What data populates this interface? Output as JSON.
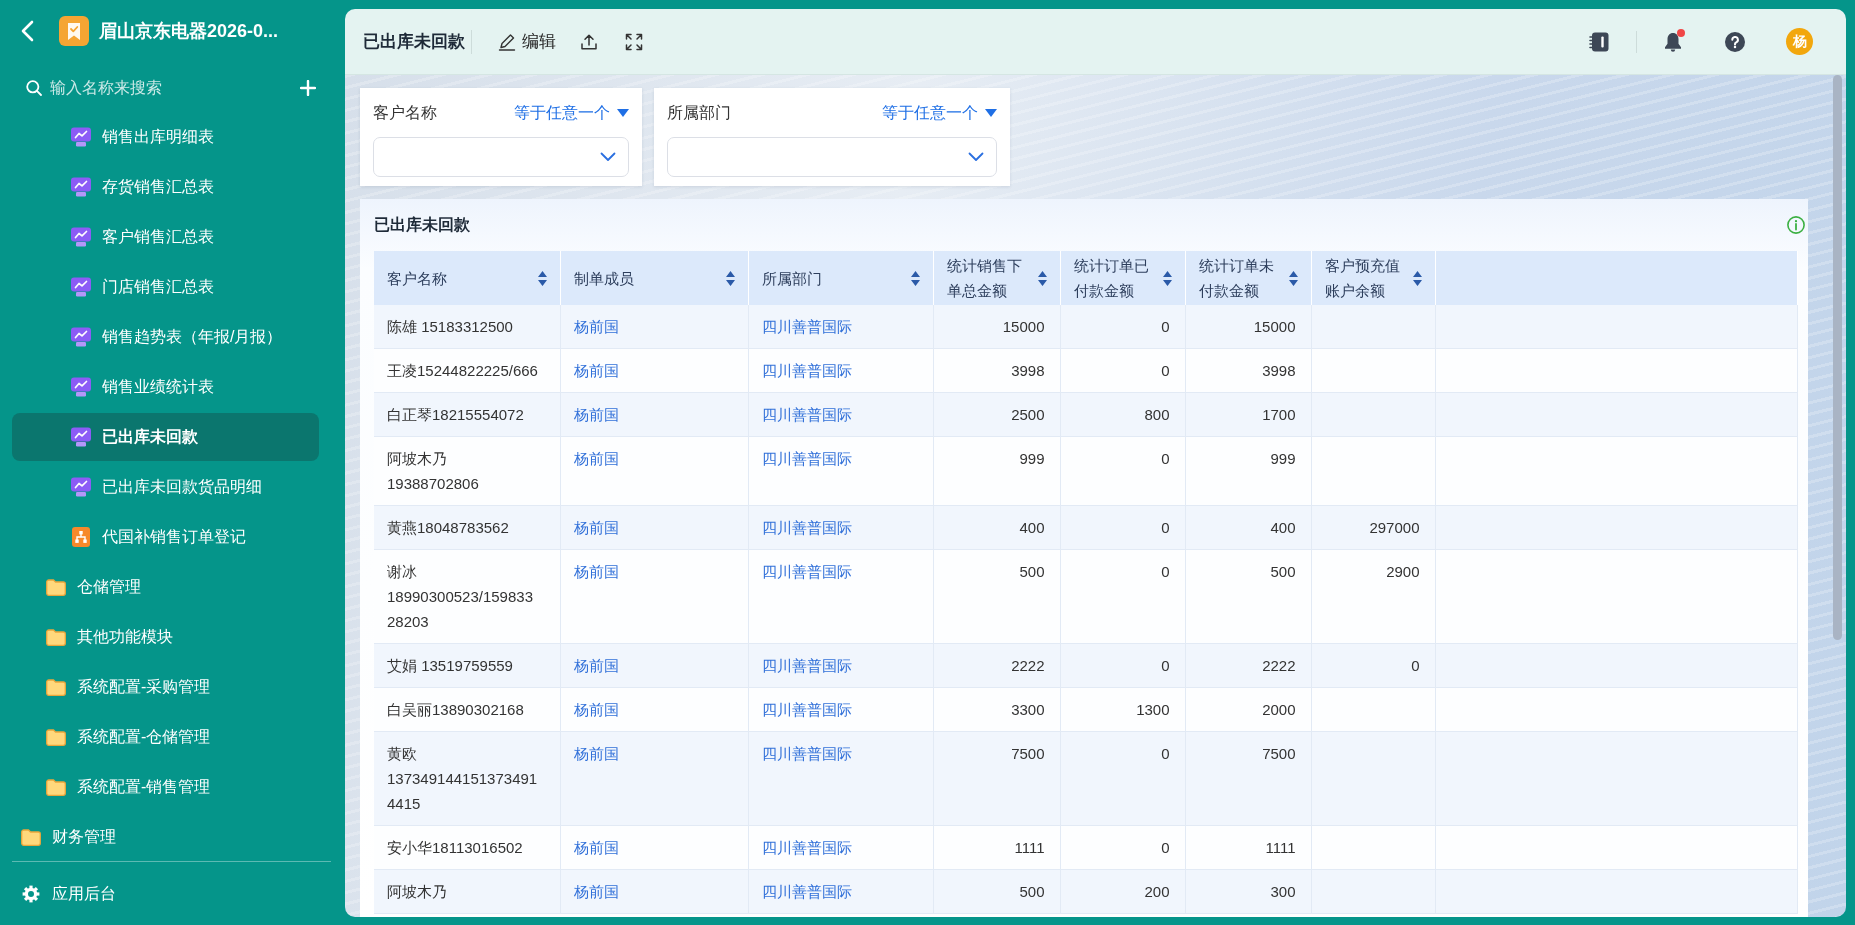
{
  "sidebar": {
    "app_title": "眉山京东电器2026-0...",
    "search": {
      "placeholder": "输入名称来搜索"
    },
    "tree": [
      {
        "children": [
          {
            "children": [
              {
                "label": "销售出库明细表",
                "kind": "report",
                "selected": false
              },
              {
                "label": "存货销售汇总表",
                "kind": "report",
                "selected": false
              },
              {
                "label": "客户销售汇总表",
                "kind": "report",
                "selected": false
              },
              {
                "label": "门店销售汇总表",
                "kind": "report",
                "selected": false
              },
              {
                "label": "销售趋势表（年报/月报）",
                "kind": "report",
                "selected": false
              },
              {
                "label": "销售业绩统计表",
                "kind": "report",
                "selected": false
              },
              {
                "label": "已出库未回款",
                "kind": "report",
                "selected": true
              },
              {
                "label": "已出库未回款货品明细",
                "kind": "report",
                "selected": false
              },
              {
                "label": "代国补销售订单登记",
                "kind": "form",
                "selected": false
              }
            ]
          },
          {
            "label": "仓储管理",
            "kind": "folder",
            "selected": false
          },
          {
            "label": "其他功能模块",
            "kind": "folder",
            "selected": false
          },
          {
            "label": "系统配置-采购管理",
            "kind": "folder",
            "selected": false
          },
          {
            "label": "系统配置-仓储管理",
            "kind": "folder",
            "selected": false
          },
          {
            "label": "系统配置-销售管理",
            "kind": "folder",
            "selected": false
          }
        ]
      },
      {
        "label": "财务管理",
        "kind": "folder",
        "selected": false
      }
    ],
    "footer": {
      "label": "应用后台"
    }
  },
  "top_bar": {
    "title": "已出库未回款",
    "actions": [
      {
        "kind": "edit",
        "label": "编辑"
      },
      {
        "kind": "upload"
      },
      {
        "kind": "fullscreen"
      }
    ],
    "tools": [
      {
        "kind": "notebook"
      },
      {
        "kind": "bell",
        "unread": true
      },
      {
        "kind": "help"
      }
    ],
    "avatar": {
      "label": "杨"
    }
  },
  "filters": [
    {
      "label": "客户名称",
      "operator": "等于任意一个"
    },
    {
      "label": "所属部门",
      "operator": "等于任意一个"
    }
  ],
  "report": {
    "title": "已出库未回款",
    "columns": [
      {
        "label": "客户名称",
        "kind": "text"
      },
      {
        "label": "制单成员",
        "kind": "link"
      },
      {
        "label": "所属部门",
        "kind": "link"
      },
      {
        "label": "统计销售下单总金额",
        "kind": "number"
      },
      {
        "label": "统计订单已付款金额",
        "kind": "number"
      },
      {
        "label": "统计订单未付款金额",
        "kind": "number"
      },
      {
        "label": "客户预充值账户余额",
        "kind": "number"
      }
    ],
    "rows": [
      [
        "陈雄 15183312500",
        "杨前国",
        "四川善普国际",
        "15000",
        "0",
        "15000",
        null
      ],
      [
        "王凌15244822225/666",
        "杨前国",
        "四川善普国际",
        "3998",
        "0",
        "3998",
        null
      ],
      [
        "白正琴18215554072",
        "杨前国",
        "四川善普国际",
        "2500",
        "800",
        "1700",
        null
      ],
      [
        "阿坡木乃 19388702806",
        "杨前国",
        "四川善普国际",
        "999",
        "0",
        "999",
        null
      ],
      [
        "黄燕18048783562",
        "杨前国",
        "四川善普国际",
        "400",
        "0",
        "400",
        "297000"
      ],
      [
        "谢冰 18990300523/15983328203",
        "杨前国",
        "四川善普国际",
        "500",
        "0",
        "500",
        "2900"
      ],
      [
        "艾娟 13519759559",
        "杨前国",
        "四川善普国际",
        "2222",
        "0",
        "2222",
        "0"
      ],
      [
        "白吴丽13890302168",
        "杨前国",
        "四川善普国际",
        "3300",
        "1300",
        "2000",
        null
      ],
      [
        "黄欧 1373491441513734914415",
        "杨前国",
        "四川善普国际",
        "7500",
        "0",
        "7500",
        null
      ],
      [
        "安小华18113016502",
        "杨前国",
        "四川善普国际",
        "1111",
        "0",
        "1111",
        null
      ],
      [
        "阿坡木乃",
        "杨前国",
        "四川善普国际",
        "500",
        "200",
        "300",
        null
      ]
    ]
  }
}
